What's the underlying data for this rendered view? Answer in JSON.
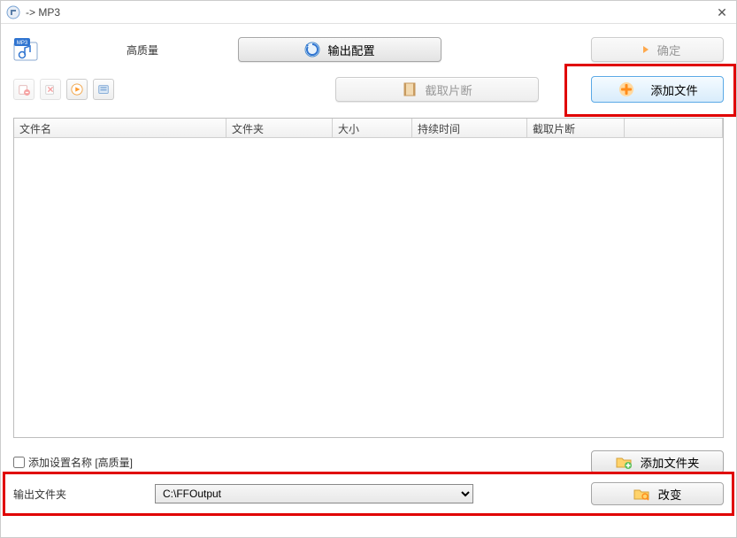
{
  "window": {
    "title": "-> MP3"
  },
  "top": {
    "quality_label": "高质量",
    "output_config_label": "输出配置",
    "confirm_label": "确定",
    "clip_label": "截取片断",
    "add_file_label": "添加文件"
  },
  "table": {
    "columns": {
      "name": "文件名",
      "folder": "文件夹",
      "size": "大小",
      "duration": "持续时间",
      "clip": "截取片断"
    }
  },
  "bottom": {
    "checkbox_label": "添加设置名称  [高质量]",
    "add_folder_label": "添加文件夹",
    "output_folder_label": "输出文件夹",
    "output_path": "C:\\FFOutput",
    "change_label": "改变"
  },
  "colors": {
    "highlight": "#e00000",
    "accent_blue": "#5aa9e6",
    "plus_orange": "#ff8c1a"
  }
}
